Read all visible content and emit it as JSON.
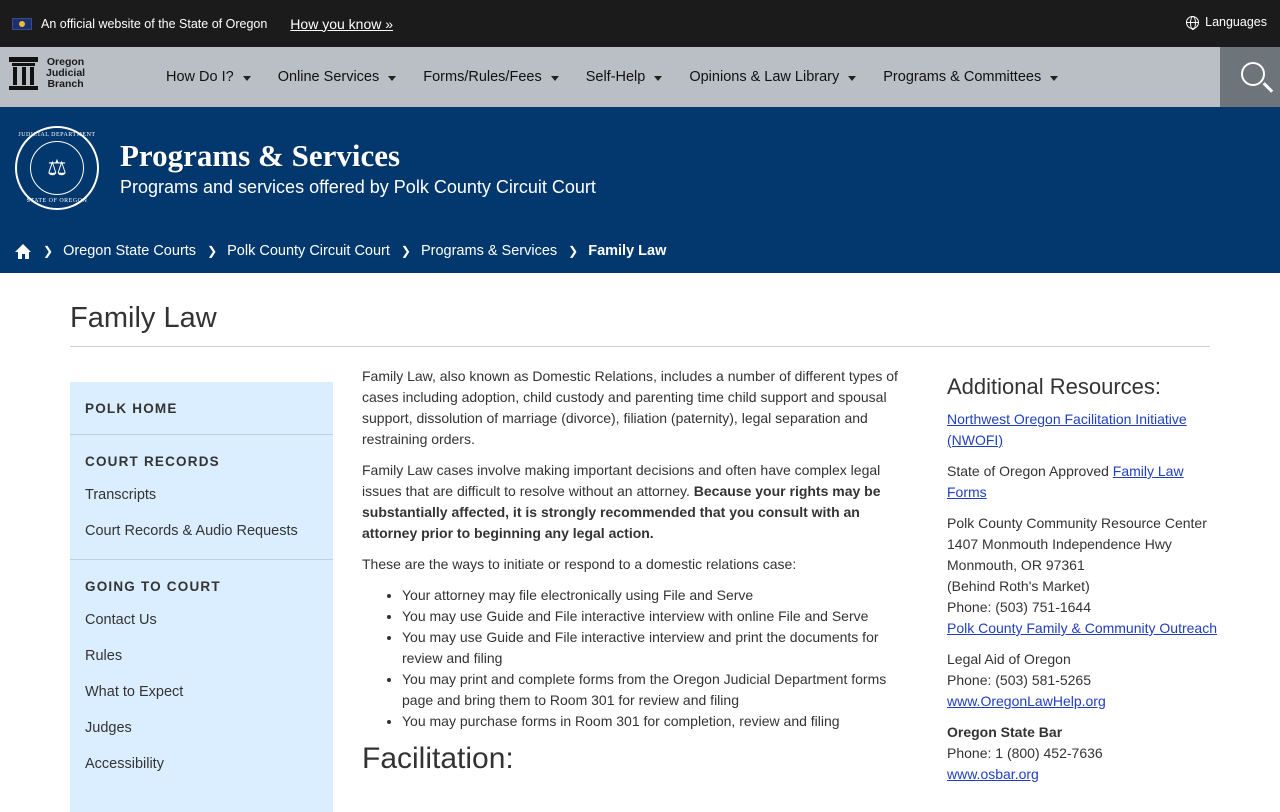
{
  "official_banner": {
    "text": "An official website of the State of Oregon",
    "how_you_know": "How you know »",
    "languages": "Languages"
  },
  "logo": {
    "line1": "Oregon",
    "line2": "Judicial",
    "line3": "Branch"
  },
  "nav": {
    "items": [
      {
        "label": "How Do I?"
      },
      {
        "label": "Online Services"
      },
      {
        "label": "Forms/Rules/Fees"
      },
      {
        "label": "Self-Help"
      },
      {
        "label": "Opinions & Law Library"
      },
      {
        "label": "Programs & Committees"
      }
    ]
  },
  "hero": {
    "seal_top": "JUDICIAL DEPARTMENT",
    "seal_bottom": "STATE OF OREGON",
    "title": "Programs & Services",
    "subtitle": "Programs and services offered by Polk County Circuit Court"
  },
  "breadcrumb": {
    "items": [
      {
        "label": "Oregon State Courts"
      },
      {
        "label": "Polk County Circuit Court"
      },
      {
        "label": "Programs & Services"
      },
      {
        "label": "Family Law"
      }
    ]
  },
  "page": {
    "title": "Family Law"
  },
  "sidebar": {
    "polk_home": "POLK HOME",
    "court_records": {
      "heading": "COURT RECORDS",
      "links": [
        "Transcripts",
        "Court Records & Audio Requests"
      ]
    },
    "going_to_court": {
      "heading": "GOING TO COURT",
      "links": [
        "Contact Us",
        "Rules",
        "What to Expect",
        "Judges",
        "Accessibility"
      ]
    }
  },
  "main": {
    "p1": "Family Law, also known as Domestic Relations, includes a number of different types of cases including adoption, child custody and parenting time child support and spousal support, dissolution of marriage (divorce), filiation (paternity), legal separation and restraining orders.",
    "p2_normal": "Family Law cases involve making important decisions and often have complex legal issues that are difficult to resolve without an attorney. ",
    "p2_bold": "Because your rights may be substantially affected, it is strongly recommended that you consult with an attorney prior to beginning any legal action.",
    "p3": "These are the ways to initiate or respond to a domestic relations case:",
    "list": [
      "Your attorney may file electronically using File and Serve",
      "You may use Guide and File interactive interview with online File and Serve",
      "You may use Guide and File interactive interview and print the documents for review and filing",
      "You may print and complete forms from the Oregon Judicial Department forms page and bring them to Room 301 for review and filing",
      "You may purchase forms in Room 301 for completion, review and filing"
    ],
    "facilitation_heading": "Facilitation:"
  },
  "aside": {
    "heading": "Additional Resources:",
    "nwofi_link": "Northwest Oregon Facilitation Initiative (NWOFI)",
    "approved_text": "State of Oregon Approved ",
    "family_law_forms_link": "Family Law Forms",
    "resource_center": {
      "name": "Polk County Community Resource Center",
      "address1": "1407 Monmouth Independence Hwy",
      "address2": "Monmouth, OR 97361",
      "note": "(Behind Roth's Market)",
      "phone": "Phone: (503) 751-1644",
      "link": "Polk County Family & Community Outreach"
    },
    "legal_aid": {
      "name": "Legal Aid of Oregon",
      "phone": "Phone: (503) 581-5265",
      "link": "www.OregonLawHelp.org"
    },
    "osb": {
      "name": "Oregon State Bar",
      "phone": "Phone: 1 (800) 452-7636",
      "link": "www.osbar.org"
    }
  }
}
